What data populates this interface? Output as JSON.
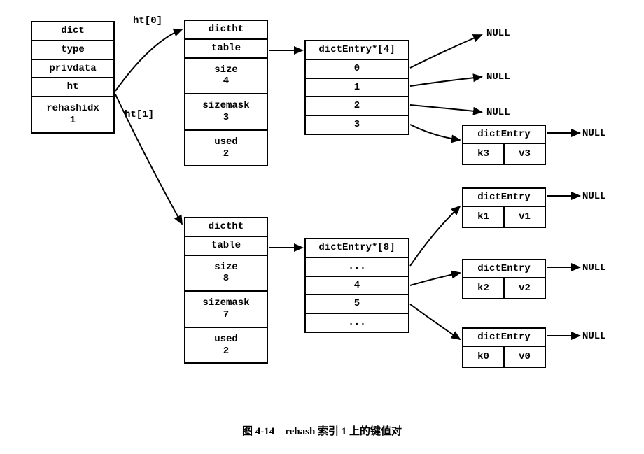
{
  "dict": {
    "title": "dict",
    "fields": [
      "type",
      "privdata",
      "ht"
    ],
    "rehashidx_label": "rehashidx",
    "rehashidx_value": "1"
  },
  "ht_labels": {
    "ht0": "ht[0]",
    "ht1": "ht[1]"
  },
  "dictht0": {
    "title": "dictht",
    "table_label": "table",
    "size_label": "size",
    "size_value": "4",
    "sizemask_label": "sizemask",
    "sizemask_value": "3",
    "used_label": "used",
    "used_value": "2"
  },
  "dictht1": {
    "title": "dictht",
    "table_label": "table",
    "size_label": "size",
    "size_value": "8",
    "sizemask_label": "sizemask",
    "sizemask_value": "7",
    "used_label": "used",
    "used_value": "2"
  },
  "arr0": {
    "title": "dictEntry*[4]",
    "rows": [
      "0",
      "1",
      "2",
      "3"
    ]
  },
  "arr1": {
    "title": "dictEntry*[8]",
    "rows": [
      "...",
      "4",
      "5",
      "..."
    ]
  },
  "entries": {
    "e0": {
      "title": "dictEntry",
      "k": "k3",
      "v": "v3"
    },
    "e1": {
      "title": "dictEntry",
      "k": "k1",
      "v": "v1"
    },
    "e2": {
      "title": "dictEntry",
      "k": "k2",
      "v": "v2"
    },
    "e3": {
      "title": "dictEntry",
      "k": "k0",
      "v": "v0"
    }
  },
  "null_label": "NULL",
  "caption": "图 4-14　rehash 索引 1 上的键值对"
}
